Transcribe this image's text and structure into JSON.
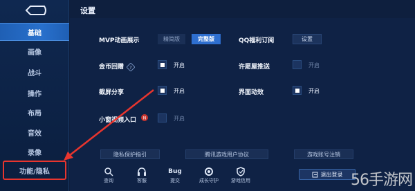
{
  "header": {
    "title": "设置"
  },
  "sidebar": {
    "items": [
      {
        "label": "基础",
        "active": true
      },
      {
        "label": "画像",
        "active": false
      },
      {
        "label": "战斗",
        "active": false
      },
      {
        "label": "操作",
        "active": false
      },
      {
        "label": "布局",
        "active": false
      },
      {
        "label": "音效",
        "active": false
      },
      {
        "label": "录像",
        "active": false
      },
      {
        "label": "功能/隐私",
        "active": false
      }
    ]
  },
  "settings": {
    "mvp": {
      "label": "MVP动画展示",
      "options": [
        "精简版",
        "完整版"
      ],
      "selected": "完整版"
    },
    "qq": {
      "label": "QQ福利订阅",
      "button": "设置"
    },
    "gold": {
      "label": "金币回赠",
      "state": "开启",
      "checked": true
    },
    "wish": {
      "label": "许愿屋推送",
      "state": "开启",
      "checked": false
    },
    "screenshot": {
      "label": "截屏分享",
      "state": "开启",
      "checked": true
    },
    "ui_anim": {
      "label": "界面动效",
      "state": "开启",
      "checked": true
    },
    "minigame": {
      "label": "小窗视频入口",
      "state": "开启",
      "checked": false
    }
  },
  "links": {
    "privacy": "隐私保护指引",
    "agreement": "腾讯游戏用户协议",
    "account_cancel": "游戏账号注销"
  },
  "bottom_bar": {
    "items": [
      {
        "label": "查询",
        "icon": "search-icon"
      },
      {
        "label": "客服",
        "icon": "headset-icon"
      },
      {
        "label": "提交",
        "icon": "bug-icon",
        "caption": "Bug"
      },
      {
        "label": "成长守护",
        "icon": "shield-ring-icon"
      },
      {
        "label": "游戏信用",
        "icon": "credit-shield-icon"
      }
    ],
    "logout": "退出登录"
  },
  "watermark": "56手游网",
  "colors": {
    "accent": "#2e6fd0",
    "background": "#0f2245",
    "annotation": "#e8352e"
  }
}
